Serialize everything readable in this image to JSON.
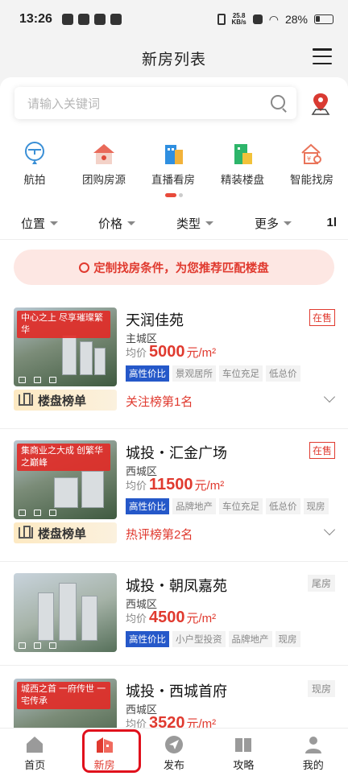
{
  "status": {
    "time": "13:26",
    "net_speed_top": "25.8",
    "net_speed_bottom": "KB/s",
    "battery": "28%"
  },
  "header": {
    "title": "新房列表"
  },
  "search": {
    "placeholder": "请输入关键词"
  },
  "categories": [
    {
      "label": "航拍",
      "icon": "drone-icon"
    },
    {
      "label": "团购房源",
      "icon": "group-buy-house-icon"
    },
    {
      "label": "直播看房",
      "icon": "live-view-building-icon"
    },
    {
      "label": "精装楼盘",
      "icon": "furnished-building-icon"
    },
    {
      "label": "智能找房",
      "icon": "smart-search-icon"
    }
  ],
  "filters": {
    "location": "位置",
    "price": "价格",
    "type": "类型",
    "more": "更多",
    "sort": "1l"
  },
  "banner": {
    "text": "定制找房条件，为您推荐匹配楼盘"
  },
  "listings": [
    {
      "tagline": "中心之上 尽享璀璨繁华",
      "name": "天润佳苑",
      "district": "主城区",
      "price_label": "均价",
      "price": "5000",
      "unit": "元/m²",
      "status": "在售",
      "tags": [
        "高性价比",
        "景观居所",
        "车位充足",
        "低总价"
      ],
      "rank_badge": "楼盘榜单",
      "rank_text": "关注榜第1名"
    },
    {
      "tagline": "集商业之大成 创繁华之巅峰",
      "name": "城投・汇金广场",
      "district": "西城区",
      "price_label": "均价",
      "price": "11500",
      "unit": "元/m²",
      "status": "在售",
      "tags": [
        "高性价比",
        "品牌地产",
        "车位充足",
        "低总价",
        "现房"
      ],
      "rank_badge": "楼盘榜单",
      "rank_text": "热评榜第2名"
    },
    {
      "tagline": "",
      "name": "城投・朝凤嘉苑",
      "district": "西城区",
      "price_label": "均价",
      "price": "4500",
      "unit": "元/m²",
      "status": "尾房",
      "tags": [
        "高性价比",
        "小户型投资",
        "品牌地产",
        "现房"
      ]
    },
    {
      "tagline": "城西之首 一府传世 一宅传承",
      "name": "城投・西城首府",
      "district": "西城区",
      "price_label": "均价",
      "price": "3520",
      "unit": "元/m²",
      "status": "现房"
    }
  ],
  "tabs": [
    {
      "label": "首页"
    },
    {
      "label": "新房"
    },
    {
      "label": "发布"
    },
    {
      "label": "攻略"
    },
    {
      "label": "我的"
    }
  ],
  "colors": {
    "accent": "#e03a2f",
    "highlight_tag": "#2558c9",
    "banner_bg": "#fde7e3"
  }
}
